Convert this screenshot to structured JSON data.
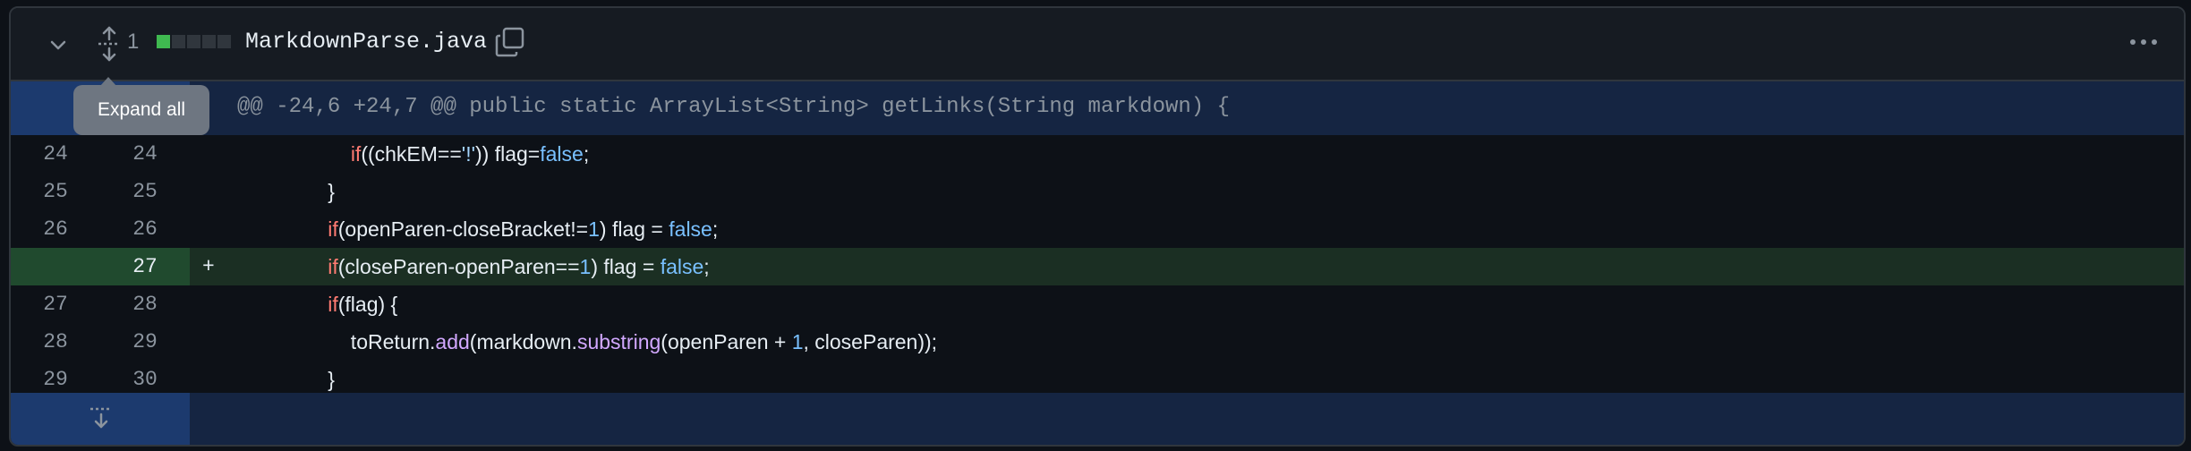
{
  "file": {
    "name": "MarkdownParse.java",
    "changes": "1",
    "diffstat": [
      "#3fb950",
      "#30363d",
      "#30363d",
      "#30363d",
      "#30363d"
    ],
    "icons": [
      "chevron-down-icon",
      "expand-all-icon",
      "copy-icon",
      "kebab-menu-icon",
      "expand-down-icon"
    ]
  },
  "hunk": {
    "header": "@@ -24,6 +24,7 @@ public static ArrayList<String> getLinks(String markdown) {"
  },
  "tooltip": {
    "text": "Expand all"
  },
  "lines": [
    {
      "old": "24",
      "new": "24",
      "marker": "",
      "segments": [
        {
          "t": "                    ",
          "c": ""
        },
        {
          "t": "if",
          "c": "kw"
        },
        {
          "t": "((chkEM==",
          "c": ""
        },
        {
          "t": "'!'",
          "c": "str"
        },
        {
          "t": ")) flag=",
          "c": ""
        },
        {
          "t": "false",
          "c": "bool"
        },
        {
          "t": ";",
          "c": ""
        }
      ]
    },
    {
      "old": "25",
      "new": "25",
      "marker": "",
      "segments": [
        {
          "t": "                }",
          "c": ""
        }
      ]
    },
    {
      "old": "26",
      "new": "26",
      "marker": "",
      "segments": [
        {
          "t": "                ",
          "c": ""
        },
        {
          "t": "if",
          "c": "kw"
        },
        {
          "t": "(openParen-closeBracket!=",
          "c": ""
        },
        {
          "t": "1",
          "c": "num"
        },
        {
          "t": ") flag = ",
          "c": ""
        },
        {
          "t": "false",
          "c": "bool"
        },
        {
          "t": ";",
          "c": ""
        }
      ]
    },
    {
      "old": "",
      "new": "27",
      "marker": "+",
      "added": true,
      "segments": [
        {
          "t": "                ",
          "c": ""
        },
        {
          "t": "if",
          "c": "kw"
        },
        {
          "t": "(closeParen-openParen==",
          "c": ""
        },
        {
          "t": "1",
          "c": "num"
        },
        {
          "t": ") flag = ",
          "c": ""
        },
        {
          "t": "false",
          "c": "bool"
        },
        {
          "t": ";",
          "c": ""
        }
      ]
    },
    {
      "old": "27",
      "new": "28",
      "marker": "",
      "segments": [
        {
          "t": "                ",
          "c": ""
        },
        {
          "t": "if",
          "c": "kw"
        },
        {
          "t": "(flag) {",
          "c": ""
        }
      ]
    },
    {
      "old": "28",
      "new": "29",
      "marker": "",
      "segments": [
        {
          "t": "                    toReturn.",
          "c": ""
        },
        {
          "t": "add",
          "c": "fn"
        },
        {
          "t": "(markdown.",
          "c": ""
        },
        {
          "t": "substring",
          "c": "fn"
        },
        {
          "t": "(openParen + ",
          "c": ""
        },
        {
          "t": "1",
          "c": "num"
        },
        {
          "t": ", closeParen));",
          "c": ""
        }
      ]
    },
    {
      "old": "29",
      "new": "30",
      "marker": "",
      "segments": [
        {
          "t": "                }",
          "c": ""
        }
      ]
    }
  ]
}
